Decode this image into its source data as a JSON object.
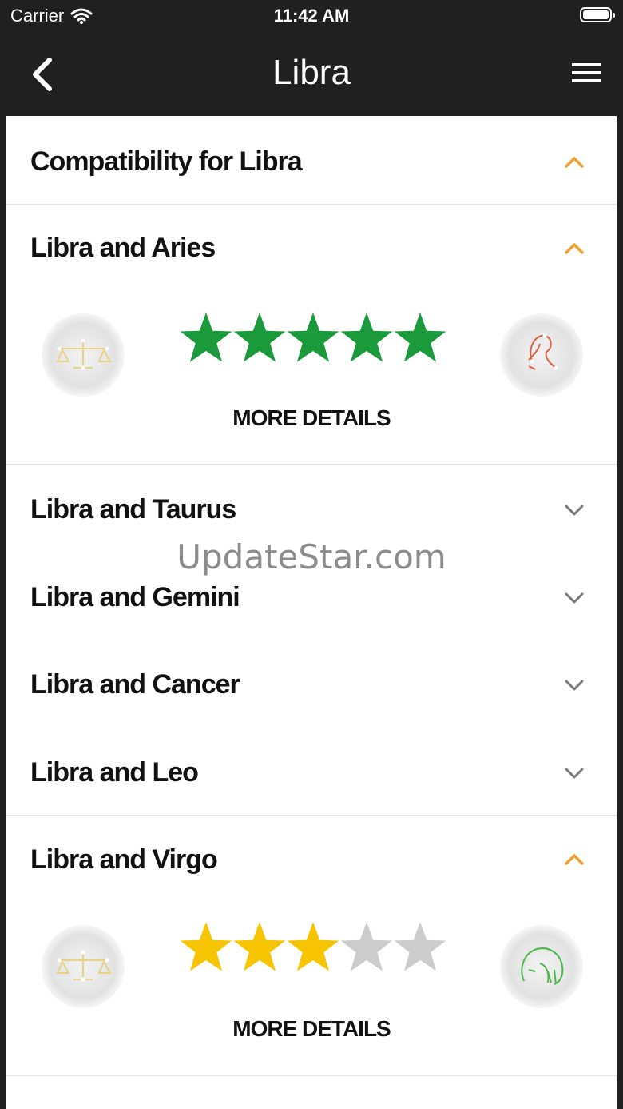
{
  "status": {
    "carrier": "Carrier",
    "time": "11:42 AM"
  },
  "nav": {
    "title": "Libra",
    "back_icon": "chevron-left-icon",
    "menu_icon": "hamburger-menu-icon"
  },
  "section": {
    "title": "Compatibility for Libra",
    "expanded": true
  },
  "pairs": [
    {
      "label": "Libra and Aries",
      "expanded": true,
      "rating": 5,
      "max_rating": 5,
      "star_color": "#1a9a3b",
      "details": "MORE DETAILS",
      "left_sign": "libra-icon",
      "right_sign": "aries-icon"
    },
    {
      "label": "Libra and Taurus",
      "expanded": false
    },
    {
      "label": "Libra and Gemini",
      "expanded": false
    },
    {
      "label": "Libra and Cancer",
      "expanded": false
    },
    {
      "label": "Libra and Leo",
      "expanded": false
    },
    {
      "label": "Libra and Virgo",
      "expanded": true,
      "rating": 3,
      "max_rating": 5,
      "star_color": "#f6c400",
      "details": "MORE DETAILS",
      "left_sign": "libra-icon",
      "right_sign": "virgo-icon"
    }
  ],
  "watermark": "UpdateStar.com",
  "colors": {
    "nav_bg": "#202020",
    "chevron_open": "#f0a030",
    "chevron_closed": "#7a7a7a",
    "star_empty": "#cccccc"
  }
}
